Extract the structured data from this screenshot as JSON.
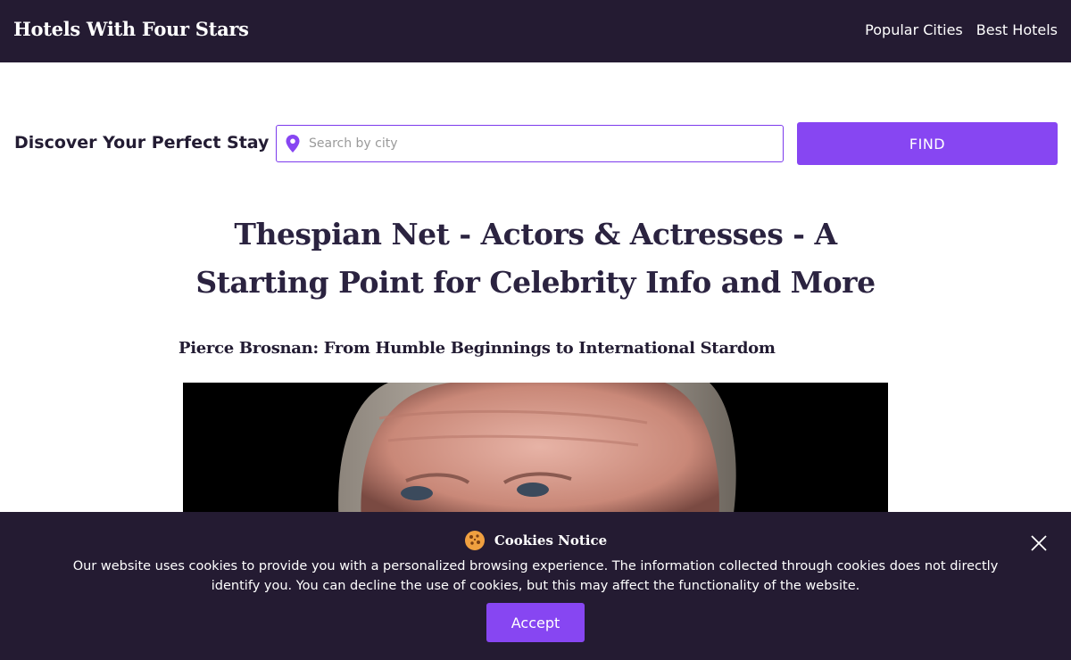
{
  "header": {
    "brand": "Hotels With Four Stars",
    "nav": [
      "Popular Cities",
      "Best Hotels"
    ]
  },
  "search": {
    "heading": "Discover Your Perfect Stay",
    "placeholder": "Search by city",
    "value": "",
    "button_label": "FIND",
    "icon": "map-pin-icon"
  },
  "article": {
    "title": "Thespian Net - Actors & Actresses - A Starting Point for Celebrity Info and More",
    "subtitle": "Pierce Brosnan: From Humble Beginnings to International Stardom"
  },
  "cookie_notice": {
    "icon": "cookie-icon",
    "title": "Cookies Notice",
    "text": "Our website uses cookies to provide you with a personalized browsing experience. The information collected through cookies does not directly identify you. You can decline the use of cookies, but this may affect the functionality of the website.",
    "accept_label": "Accept",
    "close_icon": "close-icon"
  },
  "colors": {
    "header_bg": "#241b32",
    "accent": "#8746f2",
    "heading_text": "#2b2340"
  }
}
